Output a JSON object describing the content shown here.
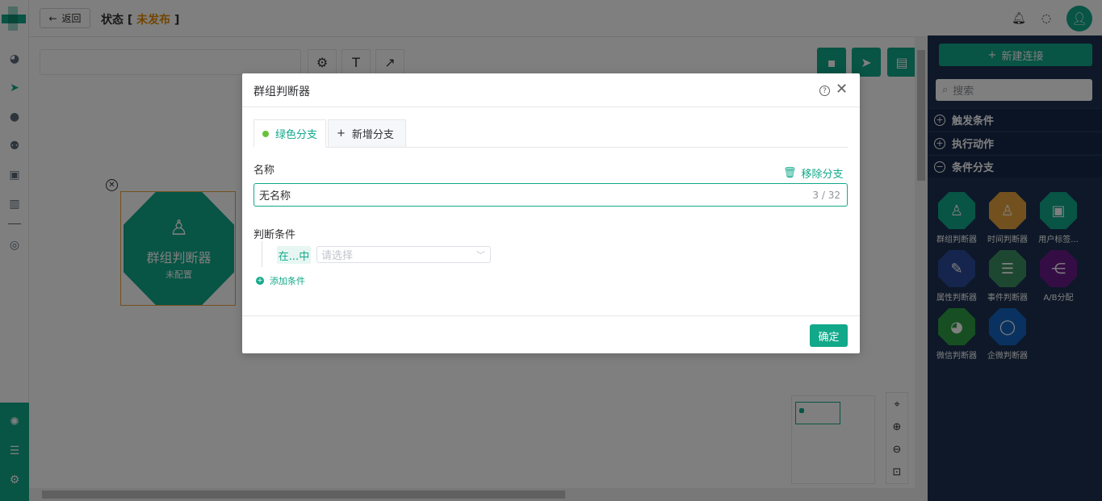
{
  "topbar": {
    "back_label": "返回",
    "status_prefix": "状态 [",
    "status_value": "未发布",
    "status_suffix": "]"
  },
  "canvas": {
    "node": {
      "title": "群组判断器",
      "subtitle": "未配置"
    }
  },
  "right_panel": {
    "new_connection_label": "新建连接",
    "search_placeholder": "搜索",
    "sections": [
      {
        "label": "触发条件",
        "expanded": false
      },
      {
        "label": "执行动作",
        "expanded": false
      },
      {
        "label": "条件分支",
        "expanded": true
      }
    ],
    "items": [
      {
        "label": "群组判断器",
        "color": "#11a98a",
        "icon": "group-user-icon"
      },
      {
        "label": "时间判断器",
        "color": "#e6a23c",
        "icon": "time-user-icon"
      },
      {
        "label": "用户标签...",
        "color": "#11a98a",
        "icon": "user-tag-icon"
      },
      {
        "label": "属性判断器",
        "color": "#2b4a9a",
        "icon": "edit-icon"
      },
      {
        "label": "事件判断器",
        "color": "#3c8f63",
        "icon": "list-icon"
      },
      {
        "label": "A/B分配",
        "color": "#6a1b8a",
        "icon": "ab-split-icon"
      },
      {
        "label": "微信判断器",
        "color": "#2f9e44",
        "icon": "wechat-icon"
      },
      {
        "label": "企微判断器",
        "color": "#1565c0",
        "icon": "wecom-icon"
      }
    ]
  },
  "dialog": {
    "title": "群组判断器",
    "tabs": [
      {
        "label": "绿色分支",
        "active": true
      },
      {
        "label": "新增分支",
        "active": false
      }
    ],
    "name_label": "名称",
    "remove_branch_label": "移除分支",
    "name_value": "无名称",
    "name_count": "3 / 32",
    "condition_label": "判断条件",
    "condition_op": "在...中",
    "condition_placeholder": "请选择",
    "add_condition_label": "添加条件",
    "confirm_label": "确定"
  },
  "colors": {
    "accent": "#11a98a",
    "status_warn": "#e68a00",
    "panel_bg": "#1d3150"
  }
}
